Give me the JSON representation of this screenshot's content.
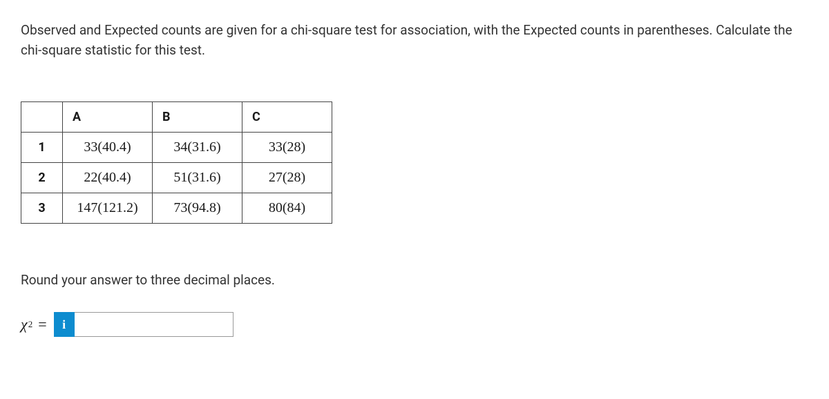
{
  "prompt": "Observed and Expected counts are given for a chi-square test for association, with the Expected counts in parentheses. Calculate the chi-square statistic for this test.",
  "table": {
    "columns": [
      "A",
      "B",
      "C"
    ],
    "rows": [
      "1",
      "2",
      "3"
    ],
    "cells": {
      "r1cA": "33(40.4)",
      "r1cB": "34(31.6)",
      "r1cC": "33(28)",
      "r2cA": "22(40.4)",
      "r2cB": "51(31.6)",
      "r2cC": "27(28)",
      "r3cA": "147(121.2)",
      "r3cB": "73(94.8)",
      "r3cC": "80(84)"
    }
  },
  "instructions": "Round your answer to three decimal places.",
  "answer": {
    "chi": "χ",
    "exponent": "2",
    "equals": "=",
    "icon_text": "i",
    "value": ""
  }
}
